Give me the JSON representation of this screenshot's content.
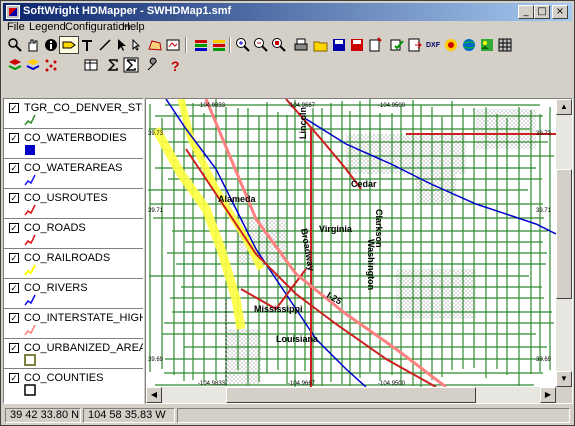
{
  "window": {
    "title": "SoftWright HDMapper - SWHDMap1.smf",
    "controls": [
      "minimize",
      "maximize",
      "close"
    ]
  },
  "menu": [
    "File",
    "Legend",
    "Configuration",
    "Help"
  ],
  "toolbar1": [
    "zoom-icon",
    "pan-hand-icon",
    "info-icon",
    "label-icon",
    "text-icon",
    "line-icon",
    "arrow-icon",
    "select-icon",
    "polygon-icon",
    "layer-icon",
    "stack-icon",
    "stack2-icon",
    "zoom-in-icon",
    "zoom-out-icon",
    "zoom-extent-icon",
    "print-icon",
    "open-icon",
    "save-icon",
    "save-as-icon",
    "new-icon",
    "properties-icon",
    "export-icon",
    "dxf-icon",
    "color-icon",
    "globe-icon",
    "image-icon",
    "grid-icon"
  ],
  "toolbar2": [
    "layers-icon",
    "layers2-icon",
    "points-icon",
    "table-icon",
    "sum-icon",
    "sum2-icon",
    "wrench-icon",
    "help-icon"
  ],
  "dxf_label": "DXF",
  "legend": [
    {
      "name": "TGR_CO_DENVER_STREETS",
      "color": "#2e8b2e",
      "symbol": "line"
    },
    {
      "name": "CO_WATERBODIES",
      "color": "#0000c8",
      "symbol": "square"
    },
    {
      "name": "CO_WATERAREAS",
      "color": "#1a1aff",
      "symbol": "line"
    },
    {
      "name": "CO_USROUTES",
      "color": "#e01010",
      "symbol": "line"
    },
    {
      "name": "CO_ROADS",
      "color": "#e01010",
      "symbol": "line"
    },
    {
      "name": "CO_RAILROADS",
      "color": "#ffff00",
      "symbol": "line"
    },
    {
      "name": "CO_RIVERS",
      "color": "#1010e0",
      "symbol": "line"
    },
    {
      "name": "CO_INTERSTATE_HIGHWAY",
      "color": "#ff8080",
      "symbol": "line"
    },
    {
      "name": "CO_URBANIZED_AREAS",
      "color": "#808040",
      "symbol": "square-outline"
    },
    {
      "name": "CO_COUNTIES",
      "color": "#000000",
      "symbol": "square-outline"
    }
  ],
  "map": {
    "labels": [
      "Alameda",
      "Cedar",
      "Virginia",
      "Clarkson",
      "Washington",
      "Lincoln",
      "Broadway",
      "Mississippi",
      "Louisiana",
      "I-25"
    ],
    "tick_labels": {
      "top": [
        "-104.9833",
        "-104.9667",
        "-104.9500"
      ],
      "bottom": [
        "-104.9833",
        "-104.9667",
        "-104.9500"
      ],
      "left": [
        "39.73",
        "39.71",
        "39.69"
      ],
      "right": [
        "39.73",
        "39.71",
        "39.69"
      ]
    }
  },
  "status": {
    "latitude": "39 42 33.80 N",
    "longitude": "104 58 35.83 W"
  }
}
